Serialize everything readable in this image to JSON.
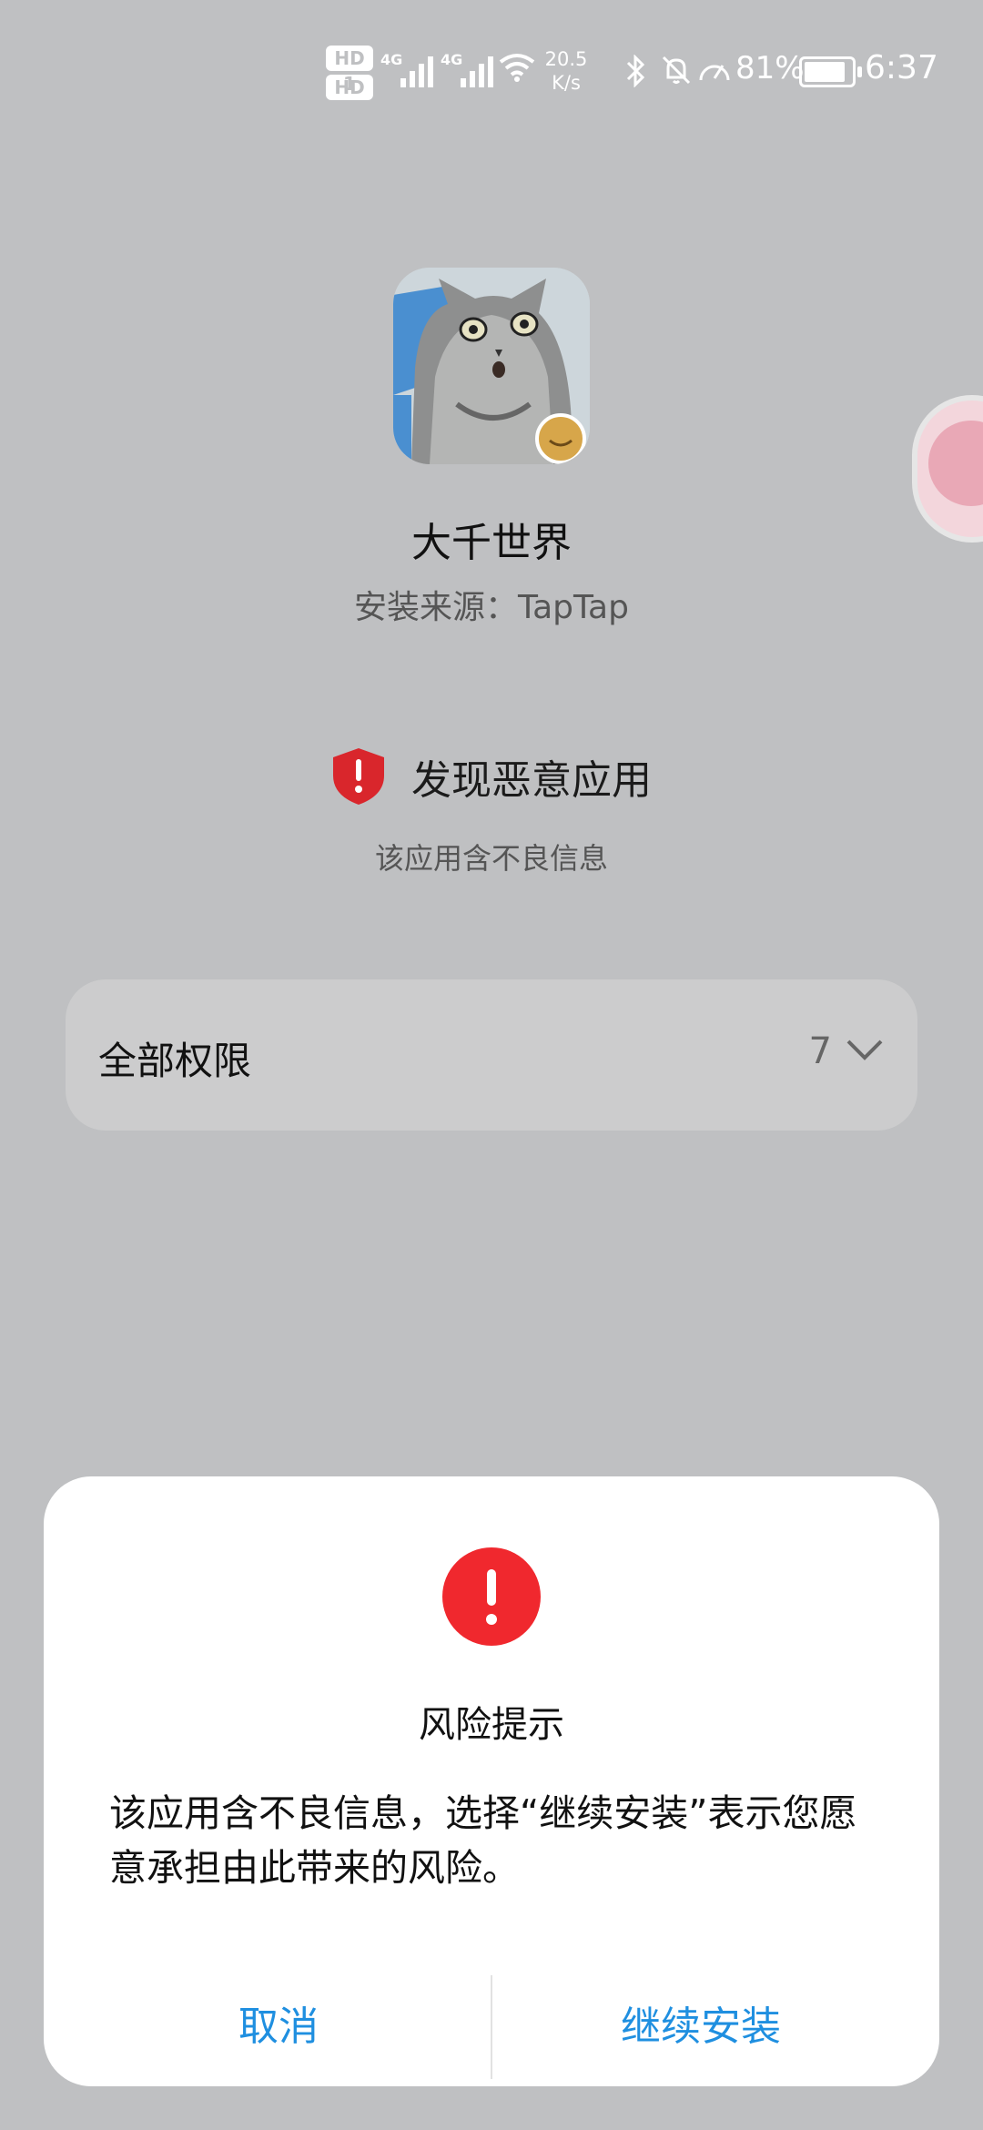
{
  "status_bar": {
    "hd1": "HD 1",
    "hd2": "HD 2",
    "signal1_label": "4G",
    "signal2_label": "4G",
    "net_speed_value": "20.5",
    "net_speed_unit": "K/s",
    "battery_percent": "81%",
    "time": "6:37"
  },
  "app": {
    "name": "大千世界",
    "install_source": "安装来源：TapTap"
  },
  "warning": {
    "title": "发现恶意应用",
    "subtitle": "该应用含不良信息",
    "color": "#d9262c"
  },
  "permissions": {
    "label": "全部权限",
    "count": "7"
  },
  "dialog": {
    "title": "风险提示",
    "message": "该应用含不良信息，选择“继续安装”表示您愿意承担由此带来的风险。",
    "cancel_label": "取消",
    "continue_label": "继续安装",
    "accent_color": "#1f8fe0",
    "icon_color": "#f0282e"
  }
}
